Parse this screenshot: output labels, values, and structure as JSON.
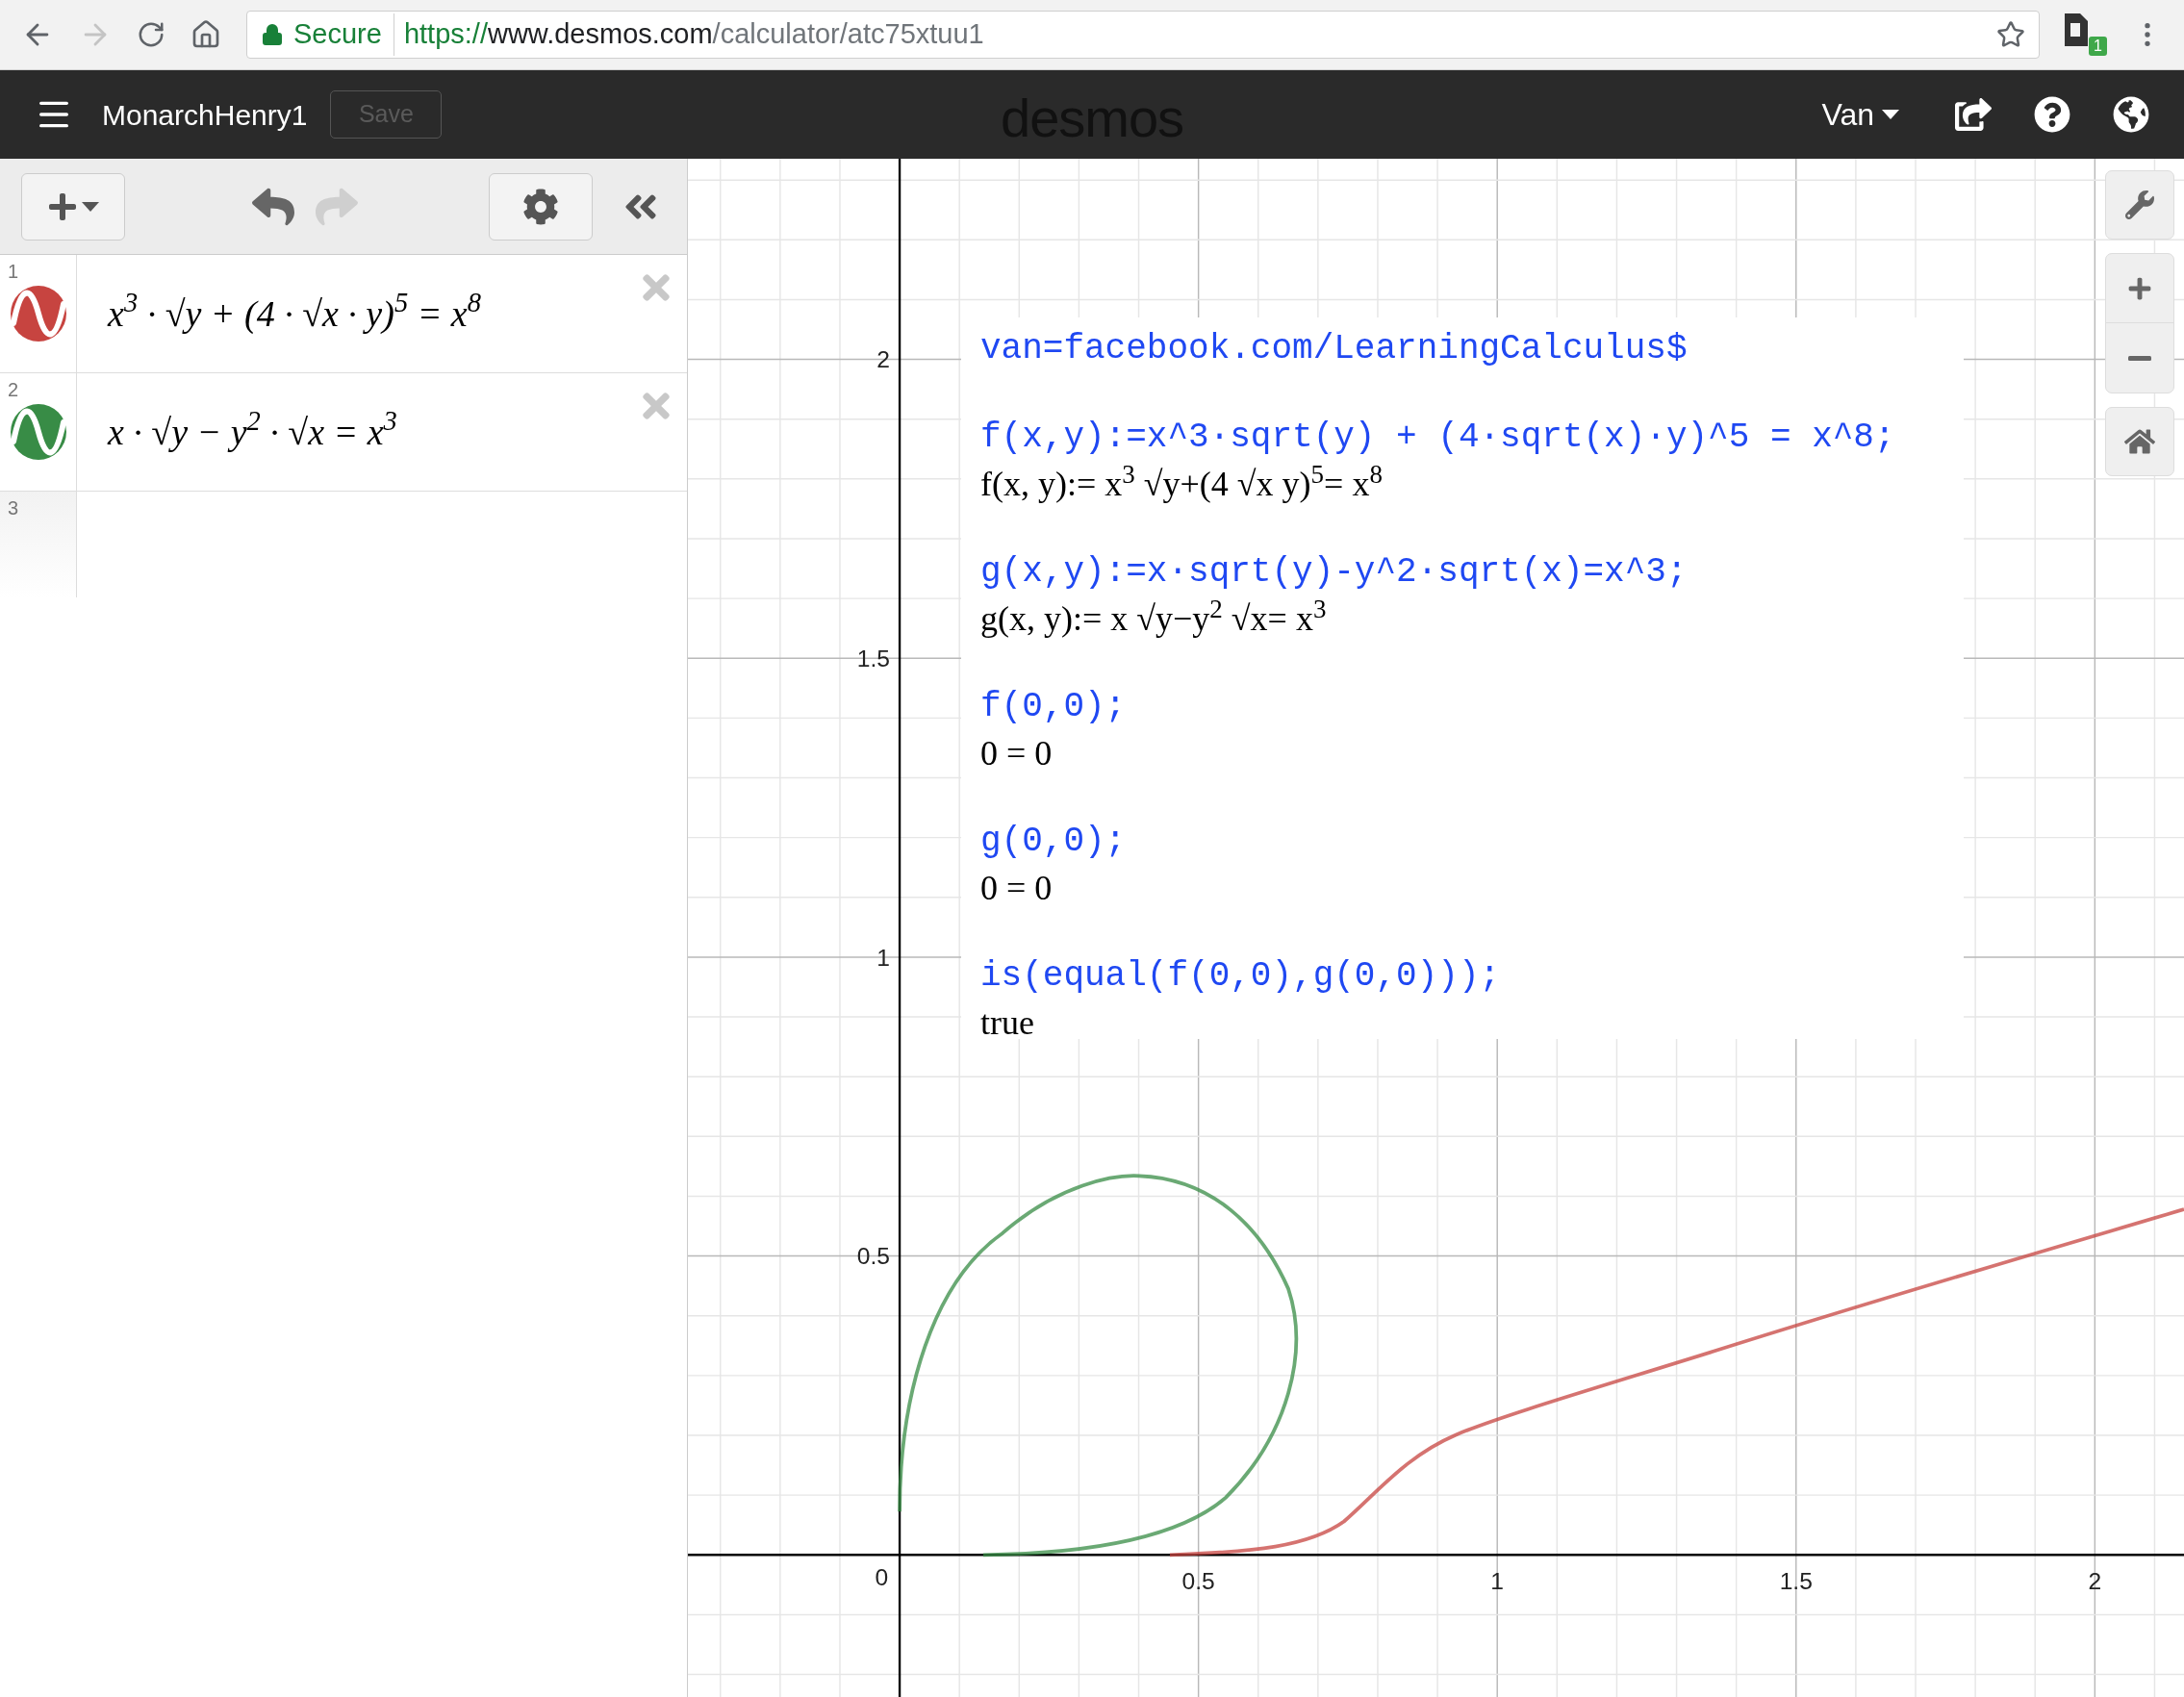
{
  "browser": {
    "forward_disabled": true,
    "security_label": "Secure",
    "url_scheme": "https://",
    "url_host": "www.desmos.com",
    "url_path": "/calculator/atc75xtuu1",
    "extension_badge": "1"
  },
  "header": {
    "username": "MonarchHenry1",
    "save_label": "Save",
    "save_disabled": true,
    "logo": "desmos",
    "account": "Van"
  },
  "toolbar": {
    "redo_disabled": true
  },
  "expressions": [
    {
      "number": "1",
      "math": "x$^{3}$ · √y + (4 · √x · y)$^{5}$ = x$^{8}$",
      "color": "#c74440"
    },
    {
      "number": "2",
      "math": "x · √y − y$^{2}$ · √x = x$^{3}$",
      "color": "#388c46"
    },
    {
      "number": "3"
    }
  ],
  "graph": {
    "origin_label": "0",
    "x_tick_labels": [
      "0.5",
      "1",
      "1.5",
      "2"
    ],
    "y_tick_labels": [
      "2",
      "1.5",
      "1",
      "0.5"
    ],
    "note": [
      {
        "input": "van=facebook.com/LearningCalculus$"
      },
      {
        "input": "f(x,y):=x^3·sqrt(y) + (4·sqrt(x)·y)^5 = x^8;",
        "output": "f(x, y):= x$^{3}$ √y+(4 √x y)$^{5}$= x$^{8}$"
      },
      {
        "input": "g(x,y):=x·sqrt(y)-y^2·sqrt(x)=x^3;",
        "output": "g(x, y):= x √y−y$^{2}$ √x= x$^{3}$"
      },
      {
        "input": "f(0,0);",
        "output": "0 = 0"
      },
      {
        "input": "g(0,0);",
        "output": "0 = 0"
      },
      {
        "input": "is(equal(f(0,0),g(0,0)));",
        "output": "true"
      }
    ]
  }
}
